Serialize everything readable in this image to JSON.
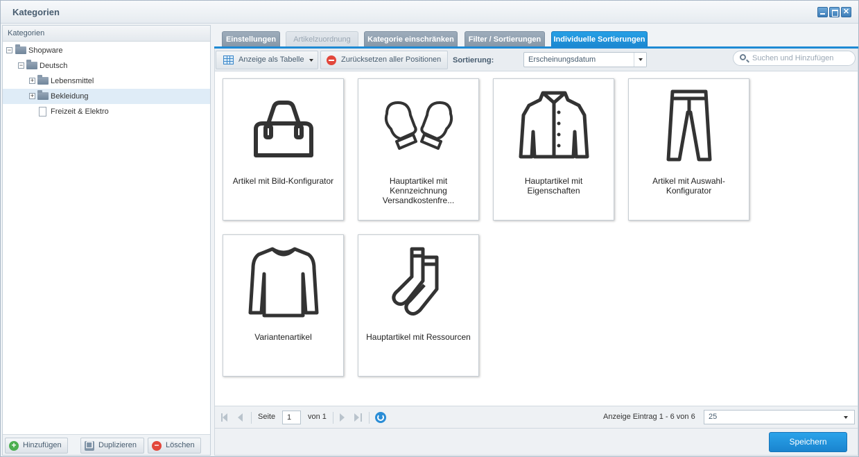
{
  "window": {
    "title": "Kategorien"
  },
  "sidebar": {
    "header": "Kategorien",
    "tree": [
      {
        "label": "Shopware",
        "expanded": true,
        "selected": false
      },
      {
        "label": "Deutsch",
        "expanded": true,
        "selected": false
      },
      {
        "label": "Lebensmittel",
        "expanded": false,
        "selected": false
      },
      {
        "label": "Bekleidung",
        "expanded": false,
        "selected": true
      },
      {
        "label": "Freizeit & Elektro",
        "leaf": true,
        "selected": false
      }
    ],
    "buttons": {
      "add": "Hinzufügen",
      "duplicate": "Duplizieren",
      "delete": "Löschen"
    }
  },
  "tabs": [
    {
      "label": "Einstellungen",
      "state": "normal"
    },
    {
      "label": "Artikelzuordnung",
      "state": "disabled"
    },
    {
      "label": "Kategorie einschränken",
      "state": "normal"
    },
    {
      "label": "Filter / Sortierungen",
      "state": "normal"
    },
    {
      "label": "Individuelle Sortierungen",
      "state": "active"
    }
  ],
  "toolbar": {
    "table_view": "Anzeige als Tabelle",
    "reset_positions": "Zurücksetzen aller Positionen",
    "sort_label": "Sortierung:",
    "sort_value": "Erscheinungsdatum",
    "search_placeholder": "Suchen und Hinzufügen"
  },
  "products": [
    {
      "name": "Artikel mit Bild-Konfigurator",
      "icon": "bag-icon"
    },
    {
      "name": "Hauptartikel mit Kennzeichnung Versandkostenfre...",
      "icon": "mittens-icon"
    },
    {
      "name": "Hauptartikel mit Eigenschaften",
      "icon": "jacket-icon"
    },
    {
      "name": "Artikel mit Auswahl-Konfigurator",
      "icon": "trousers-icon"
    },
    {
      "name": "Variantenartikel",
      "icon": "sweater-icon"
    },
    {
      "name": "Hauptartikel mit Ressourcen",
      "icon": "socks-icon"
    }
  ],
  "pager": {
    "page_label": "Seite",
    "page_value": "1",
    "of_label": "von 1",
    "display_info": "Anzeige Eintrag 1 - 6 von 6",
    "page_size": "25"
  },
  "footer": {
    "save": "Speichern"
  },
  "colors": {
    "accent": "#1e8ad4",
    "tab": "#8e9fb0",
    "delete": "#e2473b",
    "add": "#4caf50"
  }
}
